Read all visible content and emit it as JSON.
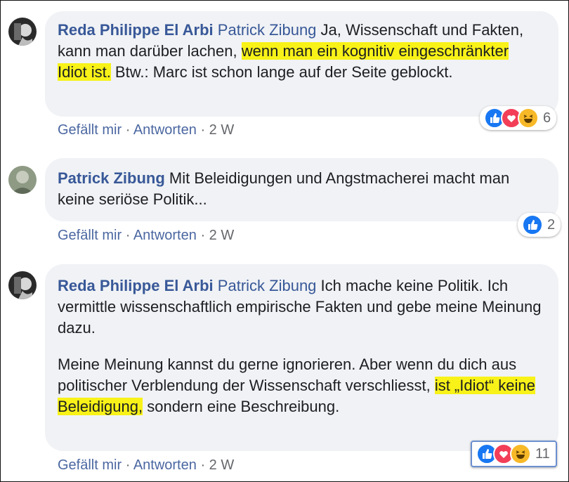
{
  "comments": [
    {
      "author": "Reda Philippe El Arbi",
      "mention": "Patrick Zibung",
      "paragraphs": [
        {
          "segments": [
            {
              "text": "Ja, Wissenschaft und Fakten, kann man darüber lachen, ",
              "highlight": false
            },
            {
              "text": "wenn man ein kognitiv eingeschränkter Idiot ist.",
              "highlight": true
            },
            {
              "text": " Btw.: Marc ist schon lange auf der Seite geblockt.",
              "highlight": false
            }
          ]
        }
      ],
      "actions": {
        "like": "Gefällt mir",
        "reply": "Antworten",
        "time": "2 W"
      },
      "reactions": {
        "types": [
          "like-icon",
          "love-icon",
          "haha-icon"
        ],
        "count": "6"
      }
    },
    {
      "author": "Patrick Zibung",
      "mention": "",
      "paragraphs": [
        {
          "segments": [
            {
              "text": "Mit Beleidigungen und Angstmacherei macht man keine seriöse Politik...",
              "highlight": false
            }
          ]
        }
      ],
      "actions": {
        "like": "Gefällt mir",
        "reply": "Antworten",
        "time": "2 W"
      },
      "reactions": {
        "types": [
          "like-icon"
        ],
        "count": "2"
      }
    },
    {
      "author": "Reda Philippe El Arbi",
      "mention": "Patrick Zibung",
      "paragraphs": [
        {
          "segments": [
            {
              "text": "Ich mache keine Politik. Ich vermittle wissenschaftlich empirische Fakten und gebe meine Meinung dazu.",
              "highlight": false
            }
          ]
        },
        {
          "segments": [
            {
              "text": "Meine Meinung kannst du gerne ignorieren. Aber wenn du dich aus politischer Verblendung der Wissenschaft verschliesst, ",
              "highlight": false
            },
            {
              "text": "ist „Idiot“ keine Beleidigung,",
              "highlight": true
            },
            {
              "text": " sondern eine Beschreibung.",
              "highlight": false
            }
          ]
        }
      ],
      "actions": {
        "like": "Gefällt mir",
        "reply": "Antworten",
        "time": "2 W"
      },
      "reactions": {
        "types": [
          "like-icon",
          "love-icon",
          "haha-icon"
        ],
        "count": "11"
      }
    }
  ],
  "colors": {
    "bubble": "#f0f2f5",
    "author": "#385898",
    "highlight": "#f8f218",
    "like": "#1877f2",
    "love": "#f33e58",
    "haha": "#f7b928"
  }
}
